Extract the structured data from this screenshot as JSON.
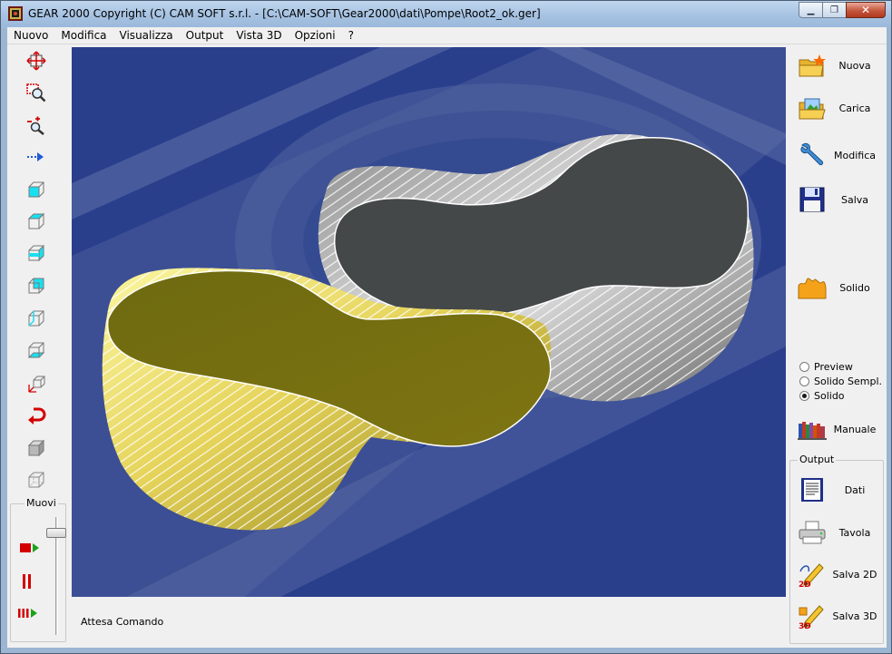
{
  "window": {
    "title": "GEAR 2000     Copyright (C)  CAM SOFT s.r.l. - [C:\\CAM-SOFT\\Gear2000\\dati\\Pompe\\Root2_ok.ger]",
    "app_icon": "gear-app-icon"
  },
  "menu": [
    "Nuovo",
    "Modifica",
    "Visualizza",
    "Output",
    "Vista 3D",
    "Opzioni",
    "?"
  ],
  "left_toolbar": {
    "tools": [
      "pan-arrows-icon",
      "zoom-window-icon",
      "zoom-in-out-icon",
      "move-right-arrow-icon",
      "view-front-cube-icon",
      "view-top-cube-icon",
      "view-right-cube-icon",
      "view-back-cube-icon",
      "view-iso-cube-icon",
      "view-bottom-cube-icon",
      "axes-iso-icon",
      "rotate-arrow-icon",
      "solid-box-icon",
      "wire-box-icon"
    ],
    "muovi_label": "Muovi",
    "playback": [
      "play-icon",
      "pause-icon",
      "fast-forward-icon"
    ]
  },
  "status_text": "Attesa Comando",
  "right_panel": {
    "buttons": [
      {
        "label": "Nuova",
        "icon": "new-folder-icon"
      },
      {
        "label": "Carica",
        "icon": "open-folder-icon"
      },
      {
        "label": "Modifica",
        "icon": "wrench-icon"
      },
      {
        "label": "Salva",
        "icon": "floppy-disk-icon"
      },
      {
        "label": "Solido",
        "icon": "solid-shape-icon"
      }
    ],
    "render_modes": [
      "Preview",
      "Solido Sempl.",
      "Solido"
    ],
    "selected_render_mode": "Solido",
    "manual": {
      "label": "Manuale",
      "icon": "books-icon"
    },
    "output_label": "Output",
    "output_buttons": [
      {
        "label": "Dati",
        "icon": "document-icon"
      },
      {
        "label": "Tavola",
        "icon": "printer-icon"
      },
      {
        "label": "Salva 2D",
        "icon": "pencil-2d-icon"
      },
      {
        "label": "Salva 3D",
        "icon": "pencil-3d-icon"
      }
    ]
  },
  "colors": {
    "viewport_bg": "#2a3f8c",
    "gear_gold": "#6f6a10",
    "gear_gray": "#444848",
    "accent_red": "#d40000"
  }
}
